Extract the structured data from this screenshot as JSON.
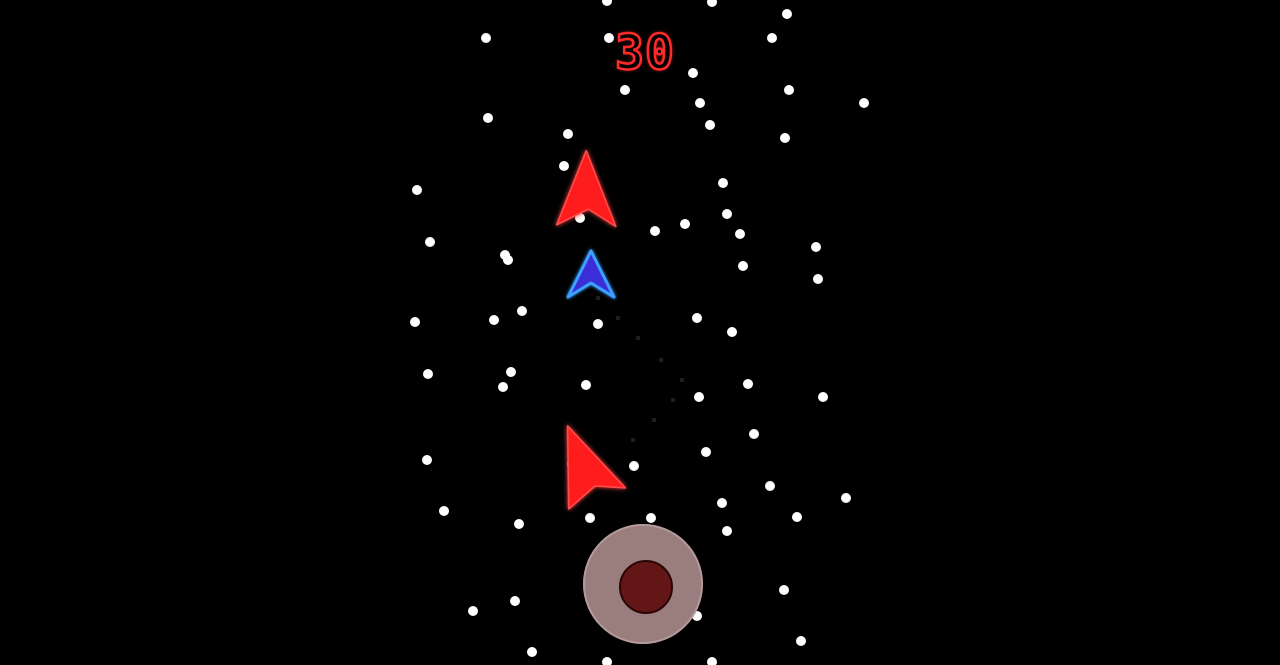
{
  "hud": {
    "score": "30"
  },
  "colors": {
    "background": "#000000",
    "enemy": "#ff1a1a",
    "player_fill": "#3b2fd6",
    "player_outline": "#3aa0ff",
    "particle": "#ffffff",
    "score": "#ff2a2a",
    "joystick_base": "#9a7d7d",
    "joystick_knob": "#621616"
  },
  "entities": {
    "player": {
      "icon": "player-ship-icon"
    },
    "enemies": [
      {
        "icon": "enemy-ship-icon"
      },
      {
        "icon": "enemy-ship-icon"
      }
    ]
  },
  "controls": {
    "joystick": "virtual-joystick"
  }
}
